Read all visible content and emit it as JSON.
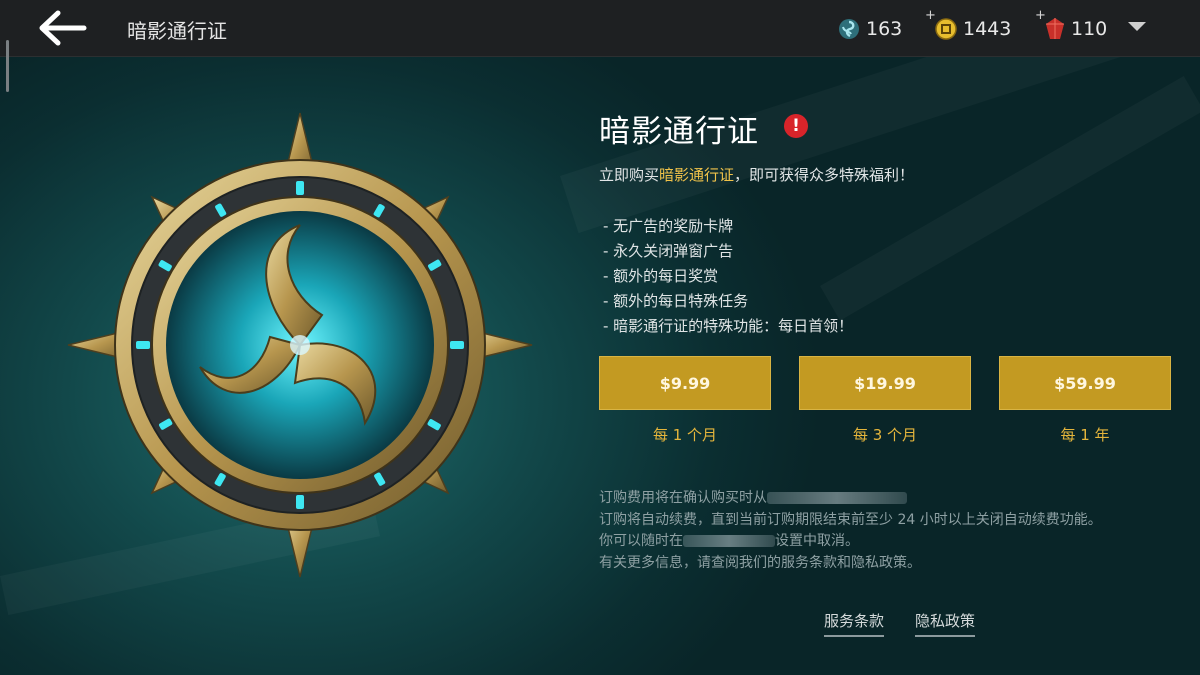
{
  "header": {
    "title": "暗影通行证",
    "back_icon": "arrow-left-icon",
    "resources": [
      {
        "name": "swirl-currency-icon",
        "value": "163",
        "color": "#7fd0d8"
      },
      {
        "name": "coin-icon",
        "value": "1443",
        "color": "#e8c23a"
      },
      {
        "name": "gem-icon",
        "value": "110",
        "color": "#d83a30"
      }
    ],
    "plus": "+"
  },
  "panel": {
    "title": "暗影通行证",
    "alert": "!",
    "intro_before": "立即购买",
    "intro_highlight": "暗影通行证",
    "intro_after": "，即可获得众多特殊福利！",
    "benefits": [
      "- 无广告的奖励卡牌",
      "- 永久关闭弹窗广告",
      "- 额外的每日奖赏",
      "- 额外的每日特殊任务",
      "- 暗影通行证的特殊功能：每日首领！"
    ]
  },
  "plans": [
    {
      "price": "$9.99",
      "period": "每 1 个月"
    },
    {
      "price": "$19.99",
      "period": "每 3 个月"
    },
    {
      "price": "$59.99",
      "period": "每 1 年"
    }
  ],
  "fine_print": {
    "line1": "订购费用将在确认购买时从",
    "line2": "订购将自动续费，直到当前订购期限结束前至少 24 小时以上关闭自动续费功能。",
    "line3_before": "你可以随时在",
    "line3_after": "设置中取消。",
    "line4": "有关更多信息，请查阅我们的服务条款和隐私政策。"
  },
  "links": {
    "terms": "服务条款",
    "privacy": "隐私政策"
  },
  "colors": {
    "accent_gold": "#c39a22",
    "highlight": "#f1c34a",
    "alert_red": "#d8242a"
  }
}
